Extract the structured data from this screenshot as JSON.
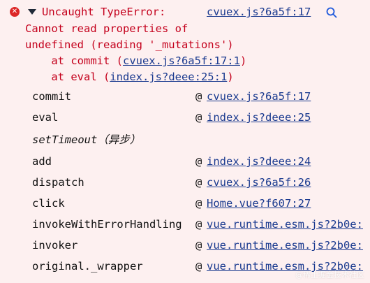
{
  "error": {
    "icon": "error-circle-icon",
    "line1": "Uncaught TypeError:",
    "line2": "Cannot read properties of",
    "line3": "undefined (reading '_mutations')",
    "line4_prefix": "    at commit (",
    "line4_link": "cvuex.js?6a5f:17:1",
    "line4_suffix": ")",
    "line5_prefix": "    at eval (",
    "line5_link": "index.js?deee:25:1",
    "line5_suffix": ")",
    "source_link": "cvuex.js?6a5f:17",
    "search_icon": "search-icon"
  },
  "stack": [
    {
      "fn": "commit",
      "at": "@",
      "loc": "cvuex.js?6a5f:17"
    },
    {
      "fn": "eval",
      "at": "@",
      "loc": "index.js?deee:25"
    },
    {
      "fn": "setTimeout（异步）",
      "async": true
    },
    {
      "fn": "add",
      "at": "@",
      "loc": "index.js?deee:24"
    },
    {
      "fn": "dispatch",
      "at": "@",
      "loc": "cvuex.js?6a5f:26"
    },
    {
      "fn": "click",
      "at": "@",
      "loc": "Home.vue?f607:27"
    },
    {
      "fn": "invokeWithErrorHandling",
      "at": "@",
      "loc": "vue.runtime.esm.js?2b0e:"
    },
    {
      "fn": "invoker",
      "at": "@",
      "loc": "vue.runtime.esm.js?2b0e:"
    },
    {
      "fn": "original._wrapper",
      "at": "@",
      "loc": "vue.runtime.esm.js?2b0e:"
    }
  ],
  "watermark": "@稀土掘金技术社区",
  "colors": {
    "background": "#fdf0f0",
    "error_text": "#c4001c",
    "link": "#1a3a8f",
    "error_icon": "#dc2626"
  }
}
